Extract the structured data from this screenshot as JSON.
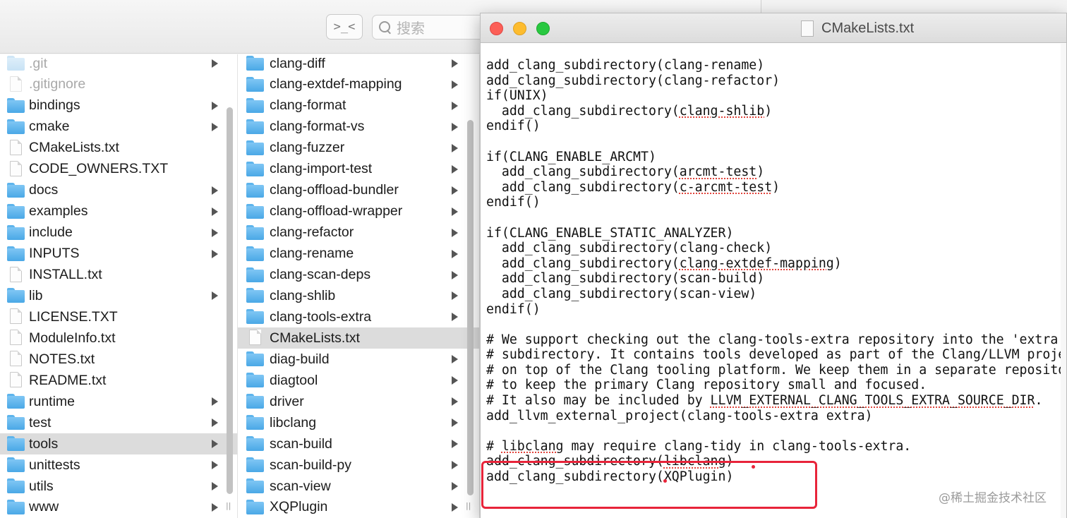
{
  "finder": {
    "terminal_button_label": ">_<",
    "search_placeholder": "搜索",
    "column1": [
      {
        "label": ".git",
        "kind": "folder",
        "dim": true,
        "has_arrow": true
      },
      {
        "label": ".gitignore",
        "kind": "file",
        "dim": true,
        "has_arrow": false
      },
      {
        "label": "bindings",
        "kind": "folder",
        "has_arrow": true
      },
      {
        "label": "cmake",
        "kind": "folder",
        "has_arrow": true
      },
      {
        "label": "CMakeLists.txt",
        "kind": "file",
        "has_arrow": false
      },
      {
        "label": "CODE_OWNERS.TXT",
        "kind": "file",
        "has_arrow": false
      },
      {
        "label": "docs",
        "kind": "folder",
        "has_arrow": true
      },
      {
        "label": "examples",
        "kind": "folder",
        "has_arrow": true
      },
      {
        "label": "include",
        "kind": "folder",
        "has_arrow": true
      },
      {
        "label": "INPUTS",
        "kind": "folder",
        "has_arrow": true
      },
      {
        "label": "INSTALL.txt",
        "kind": "file",
        "has_arrow": false
      },
      {
        "label": "lib",
        "kind": "folder",
        "has_arrow": true
      },
      {
        "label": "LICENSE.TXT",
        "kind": "file",
        "has_arrow": false
      },
      {
        "label": "ModuleInfo.txt",
        "kind": "file",
        "has_arrow": false
      },
      {
        "label": "NOTES.txt",
        "kind": "file",
        "has_arrow": false
      },
      {
        "label": "README.txt",
        "kind": "file",
        "has_arrow": false
      },
      {
        "label": "runtime",
        "kind": "folder",
        "has_arrow": true
      },
      {
        "label": "test",
        "kind": "folder",
        "has_arrow": true
      },
      {
        "label": "tools",
        "kind": "folder",
        "has_arrow": true,
        "selected": true
      },
      {
        "label": "unittests",
        "kind": "folder",
        "has_arrow": true
      },
      {
        "label": "utils",
        "kind": "folder",
        "has_arrow": true
      },
      {
        "label": "www",
        "kind": "folder",
        "has_arrow": true
      }
    ],
    "column2": [
      {
        "label": "clang-diff",
        "kind": "folder",
        "has_arrow": true
      },
      {
        "label": "clang-extdef-mapping",
        "kind": "folder",
        "has_arrow": true
      },
      {
        "label": "clang-format",
        "kind": "folder",
        "has_arrow": true
      },
      {
        "label": "clang-format-vs",
        "kind": "folder",
        "has_arrow": true
      },
      {
        "label": "clang-fuzzer",
        "kind": "folder",
        "has_arrow": true
      },
      {
        "label": "clang-import-test",
        "kind": "folder",
        "has_arrow": true
      },
      {
        "label": "clang-offload-bundler",
        "kind": "folder",
        "has_arrow": true
      },
      {
        "label": "clang-offload-wrapper",
        "kind": "folder",
        "has_arrow": true
      },
      {
        "label": "clang-refactor",
        "kind": "folder",
        "has_arrow": true
      },
      {
        "label": "clang-rename",
        "kind": "folder",
        "has_arrow": true
      },
      {
        "label": "clang-scan-deps",
        "kind": "folder",
        "has_arrow": true
      },
      {
        "label": "clang-shlib",
        "kind": "folder",
        "has_arrow": true
      },
      {
        "label": "clang-tools-extra",
        "kind": "folder",
        "has_arrow": true
      },
      {
        "label": "CMakeLists.txt",
        "kind": "file",
        "has_arrow": false,
        "selected": true
      },
      {
        "label": "diag-build",
        "kind": "folder",
        "has_arrow": true
      },
      {
        "label": "diagtool",
        "kind": "folder",
        "has_arrow": true
      },
      {
        "label": "driver",
        "kind": "folder",
        "has_arrow": true
      },
      {
        "label": "libclang",
        "kind": "folder",
        "has_arrow": true
      },
      {
        "label": "scan-build",
        "kind": "folder",
        "has_arrow": true
      },
      {
        "label": "scan-build-py",
        "kind": "folder",
        "has_arrow": true
      },
      {
        "label": "scan-view",
        "kind": "folder",
        "has_arrow": true
      },
      {
        "label": "XQPlugin",
        "kind": "folder",
        "has_arrow": true
      }
    ],
    "resize_handle": "||"
  },
  "editor": {
    "title": "CMakeLists.txt",
    "lines": [
      "add_clang_subdirectory(clang-rename)",
      "add_clang_subdirectory(clang-refactor)",
      "if(UNIX)",
      "  add_clang_subdirectory(clang-shlib)",
      "endif()",
      "",
      "if(CLANG_ENABLE_ARCMT)",
      "  add_clang_subdirectory(arcmt-test)",
      "  add_clang_subdirectory(c-arcmt-test)",
      "endif()",
      "",
      "if(CLANG_ENABLE_STATIC_ANALYZER)",
      "  add_clang_subdirectory(clang-check)",
      "  add_clang_subdirectory(clang-extdef-mapping)",
      "  add_clang_subdirectory(scan-build)",
      "  add_clang_subdirectory(scan-view)",
      "endif()",
      "",
      "# We support checking out the clang-tools-extra repository into the 'extra'",
      "# subdirectory. It contains tools developed as part of the Clang/LLVM project",
      "# on top of the Clang tooling platform. We keep them in a separate repository",
      "# to keep the primary Clang repository small and focused.",
      "# It also may be included by LLVM_EXTERNAL_CLANG_TOOLS_EXTRA_SOURCE_DIR.",
      "add_llvm_external_project(clang-tools-extra extra)",
      "",
      "# libclang may require clang-tidy in clang-tools-extra.",
      "add_clang_subdirectory(libclang)",
      "add_clang_subdirectory(XQPlugin)"
    ],
    "spellcheck_underlined": [
      "clang-shlib",
      "arcmt-test",
      "c-arcmt-test",
      "clang-extdef-mapping",
      "LLVM_EXTERNAL_CLANG_TOOLS_EXTRA_SOURCE_DIR",
      "libclang"
    ],
    "highlight_color": "#e8243a"
  },
  "watermark": "@稀土掘金技术社区"
}
